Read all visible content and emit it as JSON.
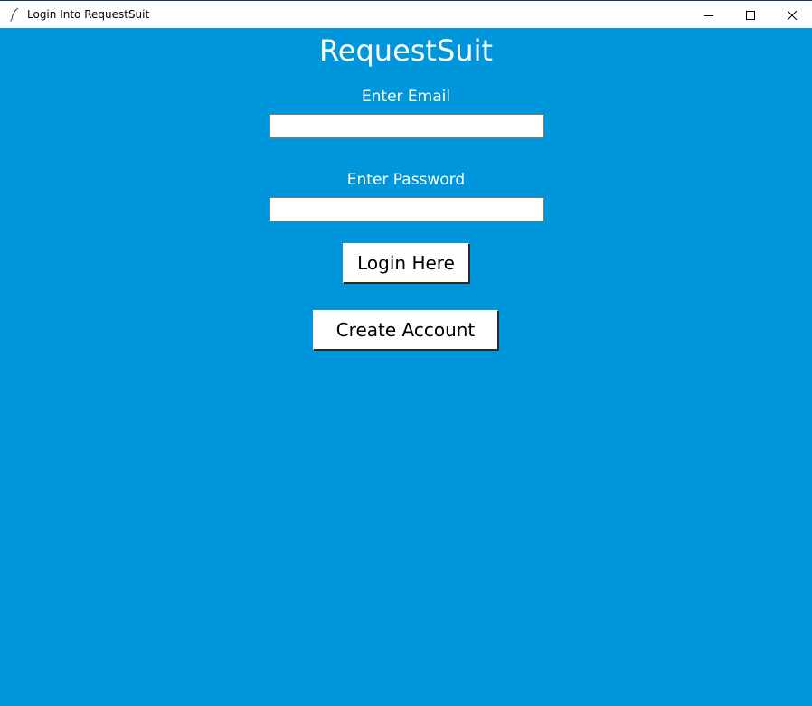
{
  "window": {
    "title": "Login Into RequestSuit",
    "icon": "feather-icon",
    "controls": [
      "minimize-icon",
      "maximize-icon",
      "close-icon"
    ]
  },
  "app": {
    "title": "RequestSuit"
  },
  "form": {
    "email_label": "Enter Email",
    "email_value": "",
    "password_label": "Enter Password",
    "password_value": "",
    "login_label": "Login Here",
    "create_label": "Create Account"
  },
  "colors": {
    "background": "#0096db",
    "titlebar": "#ffffff",
    "text": "#ffffff"
  }
}
